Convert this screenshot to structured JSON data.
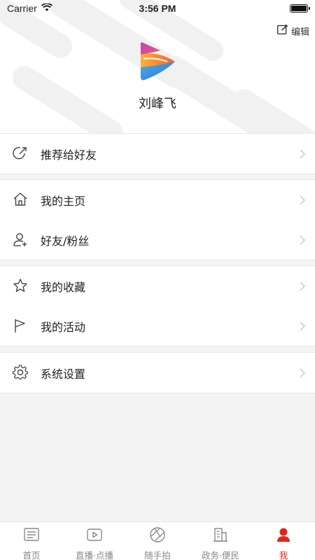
{
  "status_bar": {
    "carrier": "Carrier",
    "time": "3:56 PM"
  },
  "header": {
    "edit_label": "编辑",
    "profile_name": "刘峰飞"
  },
  "menu": {
    "recommend": "推荐给好友",
    "homepage": "我的主页",
    "friends": "好友/粉丝",
    "favorites": "我的收藏",
    "activities": "我的活动",
    "settings": "系统设置"
  },
  "tabs": [
    {
      "label": "首页",
      "icon": "news-icon"
    },
    {
      "label": "直播·点播",
      "icon": "play-icon"
    },
    {
      "label": "随手拍",
      "icon": "camera-aperture-icon"
    },
    {
      "label": "政务·便民",
      "icon": "building-icon"
    },
    {
      "label": "我",
      "icon": "person-icon",
      "active": true
    }
  ],
  "colors": {
    "accent": "#e1251b",
    "background": "#f4f4f4"
  }
}
